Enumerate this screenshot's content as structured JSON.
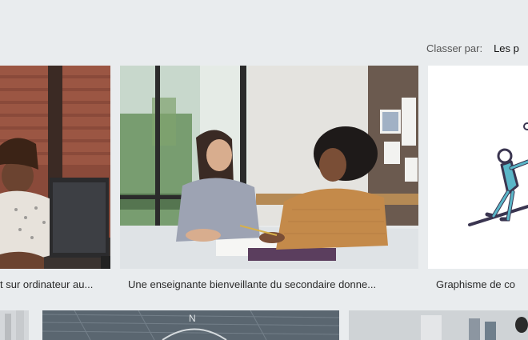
{
  "sort": {
    "label": "Classer par:",
    "value": "Les p"
  },
  "results": [
    {
      "caption": "t sur ordinateur au..."
    },
    {
      "caption": "Une enseignante bienveillante du secondaire donne..."
    },
    {
      "caption": "Graphisme de co"
    }
  ],
  "colors": {
    "background": "#e9ecee",
    "accent_teal": "#5ab6c8",
    "outline": "#3a3550"
  }
}
